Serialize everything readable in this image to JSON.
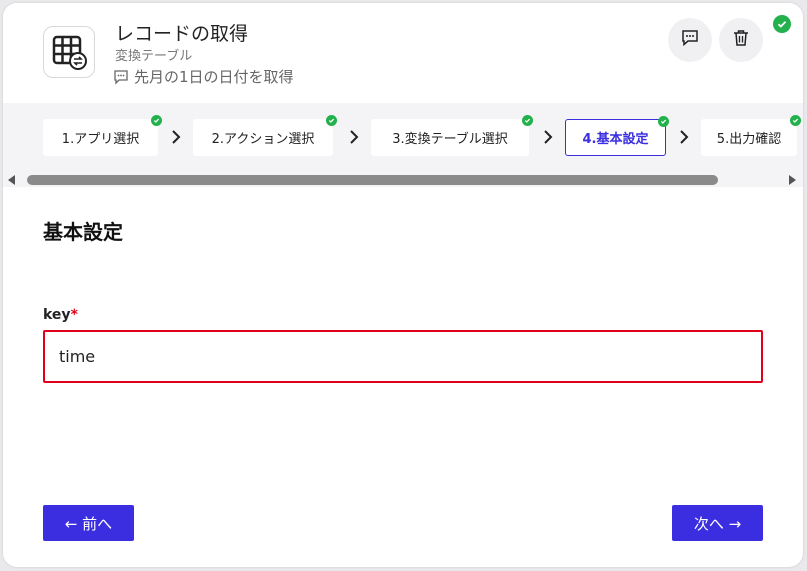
{
  "header": {
    "title": "レコードの取得",
    "subtitle": "変換テーブル",
    "memo": "先月の1日の日付を取得"
  },
  "icons": {
    "app": "table-convert-icon",
    "memo": "comment-icon",
    "comment_button": "comment-dots-icon",
    "delete_button": "trash-icon",
    "status": "check-circle-icon",
    "step_arrow": "chevron-right-icon"
  },
  "steps": [
    {
      "label": "1.アプリ選択",
      "done": true
    },
    {
      "label": "2.アクション選択",
      "done": true
    },
    {
      "label": "3.変換テーブル選択",
      "done": true
    },
    {
      "label": "4.基本設定",
      "done": true,
      "active": true
    },
    {
      "label": "5.出力確認",
      "done": true
    }
  ],
  "form": {
    "section_title": "基本設定",
    "field_label": "key",
    "required_mark": "*",
    "field_value": "time"
  },
  "nav": {
    "prev_label": "← 前へ",
    "next_label": "次へ →"
  },
  "colors": {
    "accent": "#3b2ee0",
    "success": "#22b14c",
    "error": "#e0001b"
  }
}
